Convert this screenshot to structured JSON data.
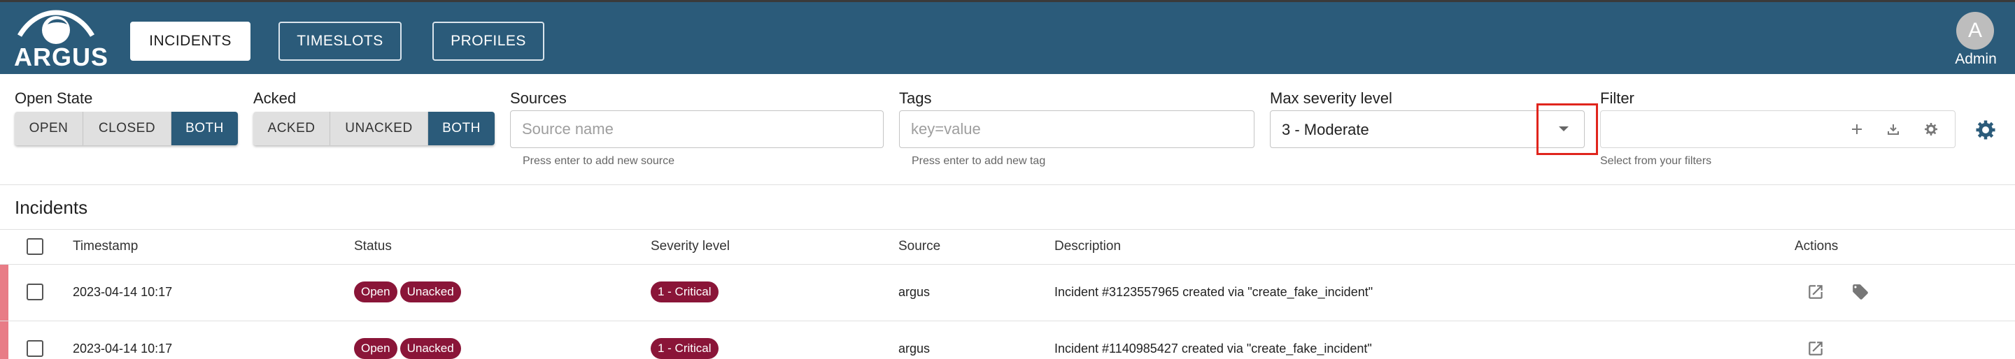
{
  "app": {
    "logo_text": "ARGUS"
  },
  "nav": {
    "items": [
      {
        "label": "INCIDENTS",
        "active": true
      },
      {
        "label": "TIMESLOTS",
        "active": false
      },
      {
        "label": "PROFILES",
        "active": false
      }
    ]
  },
  "user": {
    "initial": "A",
    "name": "Admin"
  },
  "filters": {
    "open_state": {
      "label": "Open State",
      "options": [
        "OPEN",
        "CLOSED",
        "BOTH"
      ],
      "selected": "BOTH"
    },
    "acked": {
      "label": "Acked",
      "options": [
        "ACKED",
        "UNACKED",
        "BOTH"
      ],
      "selected": "BOTH"
    },
    "sources": {
      "label": "Sources",
      "placeholder": "Source name",
      "helper": "Press enter to add new source"
    },
    "tags": {
      "label": "Tags",
      "placeholder": "key=value",
      "helper": "Press enter to add new tag"
    },
    "severity": {
      "label": "Max severity level",
      "value": "3 - Moderate"
    },
    "filter": {
      "label": "Filter",
      "helper": "Select from your filters"
    }
  },
  "incidents": {
    "title": "Incidents",
    "columns": [
      "Timestamp",
      "Status",
      "Severity level",
      "Source",
      "Description",
      "Actions"
    ],
    "rows": [
      {
        "timestamp": "2023-04-14 10:17",
        "status": [
          "Open",
          "Unacked"
        ],
        "severity": "1 - Critical",
        "source": "argus",
        "description": "Incident #3123557965 created via \"create_fake_incident\""
      },
      {
        "timestamp": "2023-04-14 10:17",
        "status": [
          "Open",
          "Unacked"
        ],
        "severity": "1 - Critical",
        "source": "argus",
        "description": "Incident #1140985427 created via \"create_fake_incident\""
      }
    ]
  },
  "colors": {
    "appbar": "#2b5b7a",
    "accent": "#2b5b7a",
    "chip": "#8a1538",
    "row_marker": "#e87c86",
    "highlight": "#e0251d"
  },
  "icons": [
    "eye-logo-icon",
    "chevron-down-icon",
    "plus-icon",
    "download-icon",
    "gear-icon",
    "settings-icon",
    "open-in-new-icon",
    "tag-icon"
  ]
}
